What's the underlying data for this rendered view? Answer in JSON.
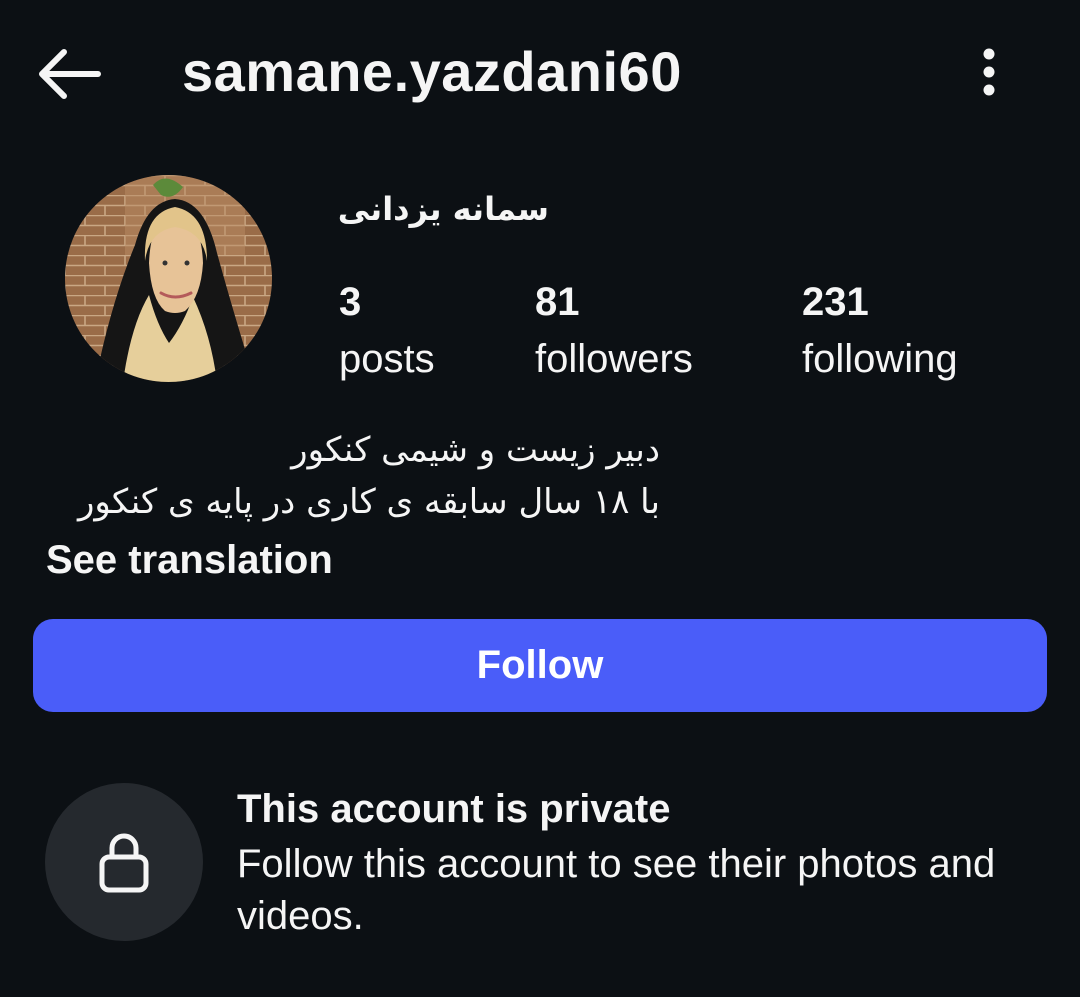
{
  "header": {
    "username": "samane.yazdani60",
    "back_icon": "arrow-left-icon",
    "more_icon": "more-vertical-icon"
  },
  "profile": {
    "display_name": "سمانه یزدانی",
    "stats": [
      {
        "value": "3",
        "label": "posts"
      },
      {
        "value": "81",
        "label": "followers"
      },
      {
        "value": "231",
        "label": "following"
      }
    ],
    "bio_lines": [
      "دبیر زیست و شیمی کنکور",
      "با ۱۸ سال سابقه ی کاری در پایه ی کنکور"
    ],
    "see_translation": "See translation"
  },
  "actions": {
    "follow_label": "Follow"
  },
  "private_notice": {
    "icon": "lock-icon",
    "title": "This account is private",
    "text": "Follow this account to see their photos and videos."
  },
  "colors": {
    "background": "#0c1014",
    "accent": "#4a5df9",
    "lock_circle": "#25292e"
  }
}
